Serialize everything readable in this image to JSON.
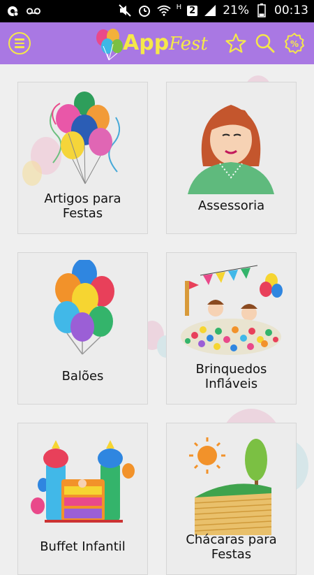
{
  "status_bar": {
    "battery_percent": "21%",
    "time": "00:13",
    "network_type": "H",
    "sim_slot": "2",
    "icons": [
      "messenger-icon",
      "voicemail-icon",
      "mute-icon",
      "alarm-icon",
      "wifi-icon",
      "signal-icon",
      "battery-icon"
    ]
  },
  "app_bar": {
    "logo_app": "App",
    "logo_fest": "Fest",
    "accent_color": "#a978e3",
    "icon_color": "#f5e84a",
    "icons": [
      "menu-icon",
      "favorites-star-icon",
      "search-icon",
      "discount-badge-icon"
    ],
    "discount_symbol": "%"
  },
  "categories": [
    {
      "label": "Artigos para\nFestas",
      "icon": "balloons-bunch-icon"
    },
    {
      "label": "Assessoria",
      "icon": "woman-avatar-icon"
    },
    {
      "label": "Balões",
      "icon": "colored-balloons-icon"
    },
    {
      "label": "Brinquedos\nInfláveis",
      "icon": "ball-pit-kids-icon"
    },
    {
      "label": "Buffet Infantil",
      "icon": "bouncy-castle-icon"
    },
    {
      "label": "Chácaras para\nFestas",
      "icon": "countryside-farm-icon"
    }
  ]
}
